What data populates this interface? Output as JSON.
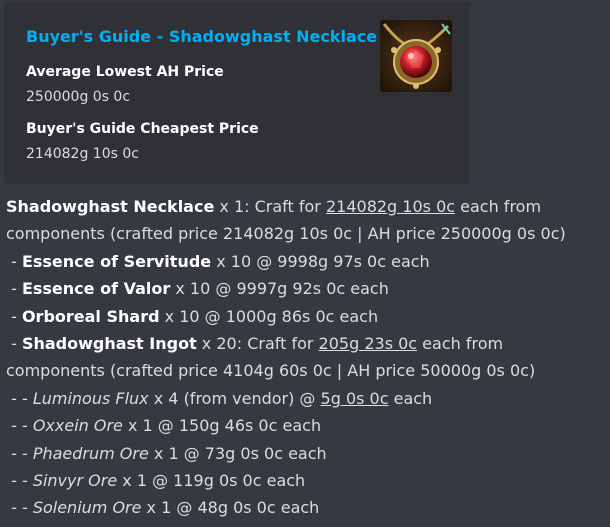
{
  "embed": {
    "title": "Buyer's Guide - Shadowghast Necklace",
    "fields": [
      {
        "name": "Average Lowest AH Price",
        "value": "250000g 0s 0c"
      },
      {
        "name": "Buyer's Guide Cheapest Price",
        "value": "214082g 10s 0c"
      }
    ],
    "thumbnail_icon": "shadowghast-necklace-icon",
    "colors": {
      "title": "#00b0f4",
      "background": "#2f3136",
      "page": "#36393f"
    }
  },
  "message": {
    "l1_name": "Shadowghast Necklace",
    "l1_a": " x 1: Craft for ",
    "l1_price": "214082g 10s 0c",
    "l1_b": " each from",
    "l2": "components (crafted price 214082g 10s 0c | AH price 250000g 0s 0c)",
    "l3_prefix": " - ",
    "l3_name": "Essence of Servitude",
    "l3_rest": " x 10 @ 9998g 97s 0c each",
    "l4_prefix": " - ",
    "l4_name": "Essence of Valor",
    "l4_rest": " x 10 @ 9997g 92s 0c each",
    "l5_prefix": " - ",
    "l5_name": "Orboreal Shard",
    "l5_rest": " x 10 @ 1000g 86s 0c each",
    "l6_prefix": " - ",
    "l6_name": "Shadowghast Ingot",
    "l6_a": " x 20: Craft for ",
    "l6_price": "205g 23s 0c",
    "l6_b": " each from",
    "l7": "components (crafted price 4104g 60s 0c | AH price 50000g 0s 0c)",
    "l8_prefix": " - - ",
    "l8_name": "Luminous Flux",
    "l8_a": " x 4 (from vendor) @ ",
    "l8_price": "5g 0s 0c",
    "l8_b": " each",
    "l9_prefix": " - - ",
    "l9_name": "Oxxein Ore",
    "l9_rest": " x 1 @ 150g 46s 0c each",
    "l10_prefix": " - - ",
    "l10_name": "Phaedrum Ore",
    "l10_rest": " x 1 @ 73g 0s 0c each",
    "l11_prefix": " - - ",
    "l11_name": "Sinvyr Ore",
    "l11_rest": " x 1 @ 119g 0s 0c each",
    "l12_prefix": " - - ",
    "l12_name": "Solenium Ore",
    "l12_rest": " x 1 @ 48g 0s 0c each"
  }
}
